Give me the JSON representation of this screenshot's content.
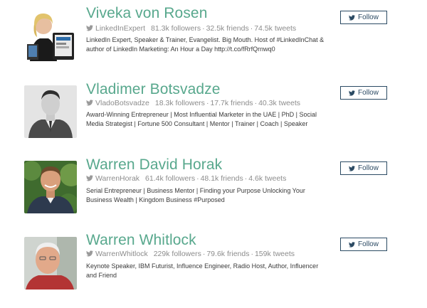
{
  "profiles": [
    {
      "name": "Viveka von Rosen",
      "handle": "LinkedInExpert",
      "followers": "81.3k followers",
      "friends": "32.5k friends",
      "tweets": "74.5k tweets",
      "bio": "LinkedIn Expert, Speaker & Trainer, Evangelist. Big Mouth. Host of #LinkedInChat & author of LinkedIn Marketing: An Hour a Day http://t.co/fRrfQrnwq0",
      "follow_label": "Follow"
    },
    {
      "name": "Vladimer Botsvadze",
      "handle": "VladoBotsvadze",
      "followers": "18.3k followers",
      "friends": "17.7k friends",
      "tweets": "40.3k tweets",
      "bio": "Award-Winning Entrepreneur | Most Influential Marketer in the UAE | PhD | Social Media Strategist | Fortune 500 Consultant | Mentor | Trainer | Coach | Speaker",
      "follow_label": "Follow"
    },
    {
      "name": "Warren David Horak",
      "handle": "WarrenHorak",
      "followers": "61.4k followers",
      "friends": "48.1k friends",
      "tweets": "4.6k tweets",
      "bio": "Serial Entrepreneur | Business Mentor | Finding your Purpose Unlocking Your Business Wealth | Kingdom Business #Purposed",
      "follow_label": "Follow"
    },
    {
      "name": "Warren Whitlock",
      "handle": "WarrenWhitlock",
      "followers": "229k followers",
      "friends": "79.6k friends",
      "tweets": "159k tweets",
      "bio": "Keynote Speaker, IBM Futurist, Influence Engineer, Radio Host, Author, Influencer and Friend",
      "follow_label": "Follow"
    }
  ],
  "separator": "·",
  "colors": {
    "name": "#58a88d",
    "button_border": "#2b4a63",
    "meta": "#8c8c8c"
  },
  "icons": {
    "bird": "twitter-bird-icon"
  }
}
